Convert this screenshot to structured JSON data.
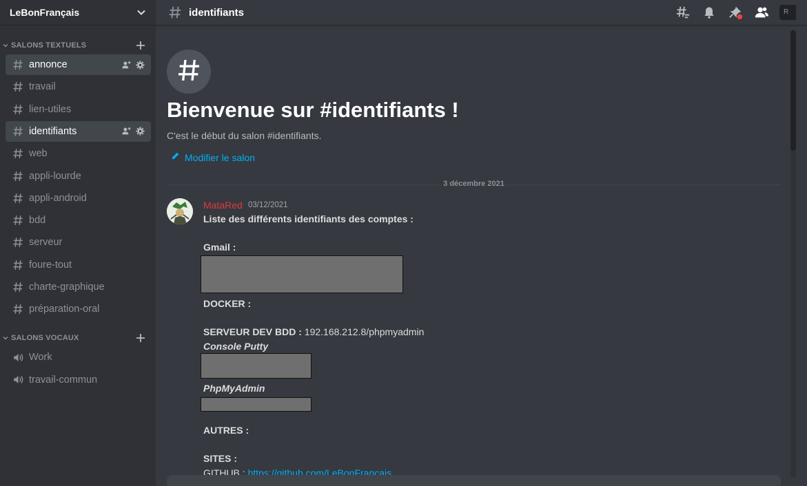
{
  "server": {
    "name": "LeBonFrançais"
  },
  "categories": {
    "text": {
      "label": "SALONS TEXTUELS"
    },
    "voice": {
      "label": "SALONS VOCAUX"
    }
  },
  "text_channels": [
    {
      "label": "annonce",
      "active": true
    },
    {
      "label": "travail"
    },
    {
      "label": "lien-utiles"
    },
    {
      "label": "identifiants",
      "active": true
    },
    {
      "label": "web"
    },
    {
      "label": "appli-lourde"
    },
    {
      "label": "appli-android"
    },
    {
      "label": "bdd"
    },
    {
      "label": "serveur"
    },
    {
      "label": "foure-tout"
    },
    {
      "label": "charte-graphique"
    },
    {
      "label": "préparation-oral"
    }
  ],
  "voice_channels": [
    {
      "label": "Work"
    },
    {
      "label": "travail-commun"
    }
  ],
  "topbar": {
    "channel": "identifiants",
    "search_initial": "R",
    "icons": [
      "threads-icon",
      "bell-icon",
      "pin-icon",
      "members-icon"
    ]
  },
  "welcome": {
    "title": "Bienvenue sur #identifiants !",
    "subtitle": "C'est le début du salon #identifiants.",
    "edit_label": "Modifier le salon"
  },
  "date_divider": "3 décembre 2021",
  "message": {
    "author": "MataRed",
    "author_color": "#d83c3e",
    "timestamp": "03/12/2021",
    "intro": "Liste des différents identifiants des comptes :",
    "gmail_label": "Gmail :",
    "docker_label": "DOCKER  :",
    "server_label": "SERVEUR DEV BDD :",
    "server_value": "192.168.212.8/phpmyadmin",
    "putty_label": "Console Putty",
    "phpmyadmin_label": "PhpMyAdmin",
    "autres_label": "AUTRES :",
    "sites_label": "SITES :",
    "github_label": "GITHUB :",
    "github_url": "https://github.com/LeBonFrancais"
  },
  "colors": {
    "sidebar_bg": "#2f3136",
    "main_bg": "#36393f",
    "active_channel_bg": "#42464d",
    "link": "#00aff4",
    "redaction": "#6f6f6f"
  }
}
